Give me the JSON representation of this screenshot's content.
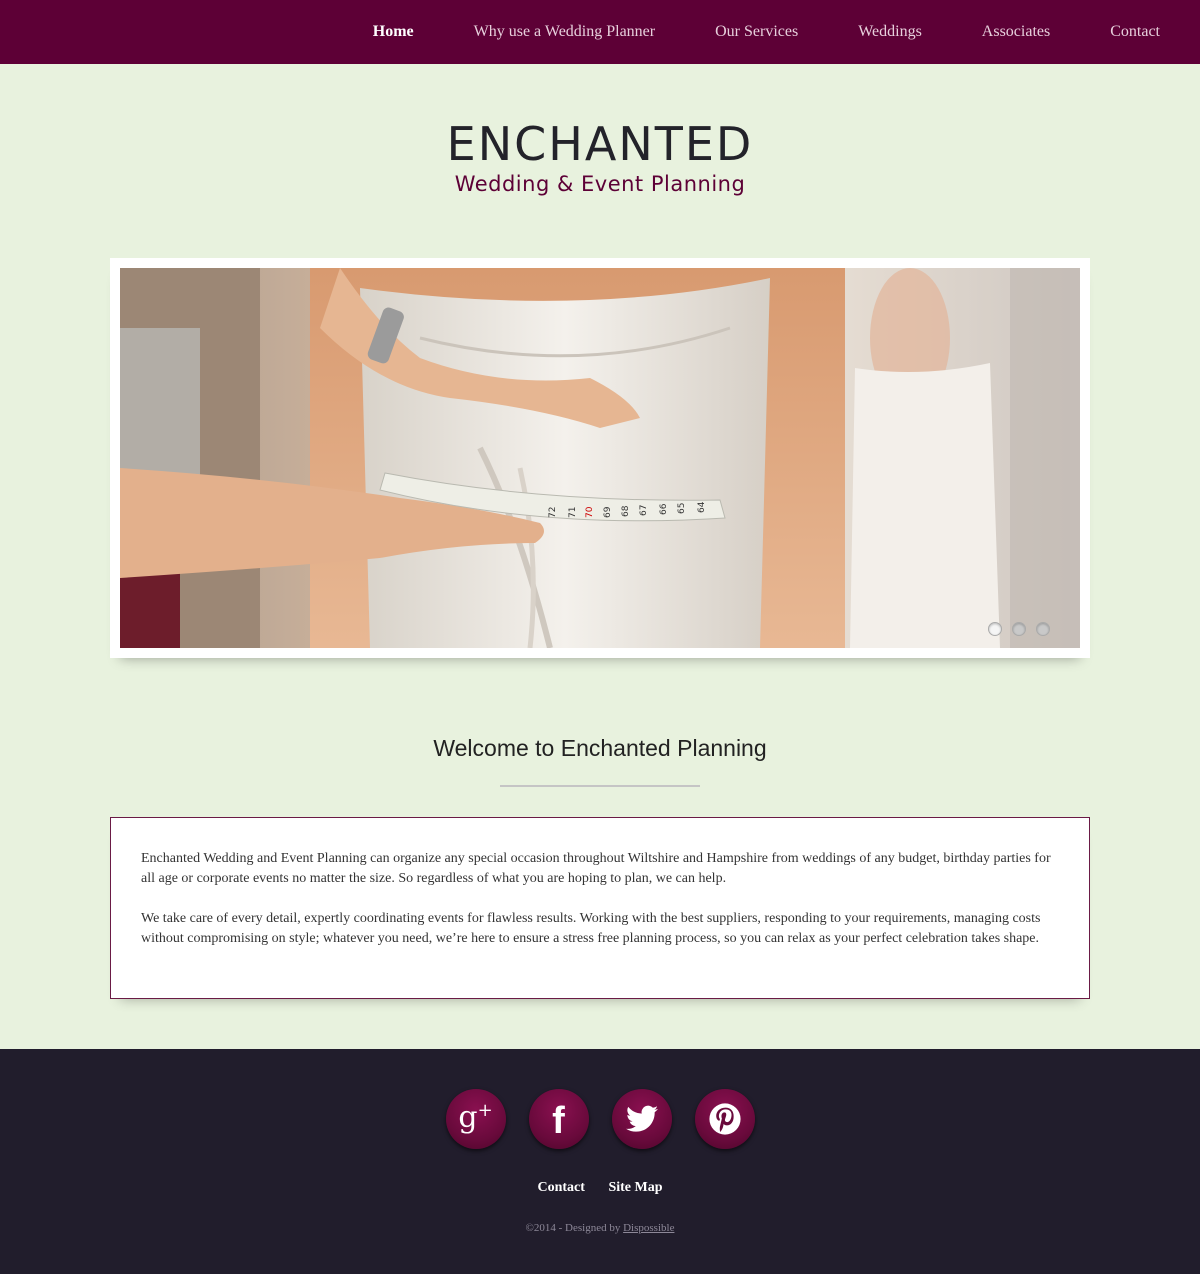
{
  "nav": {
    "items": [
      "Home",
      "Why use a Wedding Planner",
      "Our Services",
      "Weddings",
      "Associates",
      "Contact"
    ],
    "active_index": 0
  },
  "logo": {
    "line1": "ENCHANTED",
    "line2": "Wedding & Event Planning"
  },
  "slider": {
    "image_subject": "bride being measured with tape measure in wedding dress",
    "tape_numbers": [
      "72",
      "71",
      "70",
      "69",
      "68",
      "67",
      "66",
      "65",
      "64"
    ],
    "slide_count": 3,
    "active_slide": 1
  },
  "welcome": {
    "heading": "Welcome to Enchanted Planning"
  },
  "content": {
    "paragraphs": [
      "Enchanted Wedding and Event Planning can organize any special occasion throughout Wiltshire and Hampshire from weddings of any budget, birthday parties for all age or corporate events no matter the size. So regardless of what you are hoping to plan, we can help.",
      "We take care of every detail, expertly coordinating events for flawless results. Working with the best suppliers, responding to your requirements, managing costs without compromising on style; whatever you need, we’re here to ensure a stress free planning process, so you can relax as your perfect celebration takes shape."
    ]
  },
  "footer": {
    "social": [
      {
        "name": "google-plus",
        "label": "g+"
      },
      {
        "name": "facebook",
        "label": "f"
      },
      {
        "name": "twitter",
        "label": ""
      },
      {
        "name": "pinterest",
        "label": ""
      }
    ],
    "links": [
      "Contact",
      "Site Map"
    ],
    "copyright_prefix": "©2014 - Designed by ",
    "designer": "Dispossible"
  },
  "colors": {
    "nav_bg": "#5d0036",
    "page_bg": "#e8f2de",
    "footer_bg": "#211d2c",
    "accent": "#5d0036"
  }
}
